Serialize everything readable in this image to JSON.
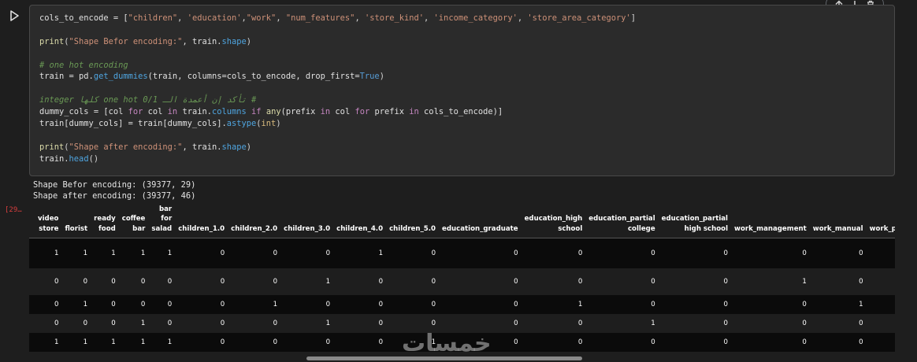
{
  "toolbar": {
    "move_up_icon": "arrow-up-icon",
    "move_down_icon": "arrow-down-icon",
    "delete_icon": "trash-icon"
  },
  "cell": {
    "run_icon": "play-icon",
    "execution_count": "[29…",
    "code_lines": [
      [
        {
          "t": "cols_to_encode = [",
          "c": "v"
        },
        {
          "t": "\"children\"",
          "c": "s"
        },
        {
          "t": ", ",
          "c": "p"
        },
        {
          "t": "'education'",
          "c": "s"
        },
        {
          "t": ",",
          "c": "p"
        },
        {
          "t": "\"work\"",
          "c": "s"
        },
        {
          "t": ", ",
          "c": "p"
        },
        {
          "t": "\"num_features\"",
          "c": "s"
        },
        {
          "t": ", ",
          "c": "p"
        },
        {
          "t": "'store_kind'",
          "c": "s"
        },
        {
          "t": ", ",
          "c": "p"
        },
        {
          "t": "'income_category'",
          "c": "s"
        },
        {
          "t": ", ",
          "c": "p"
        },
        {
          "t": "'store_area_category'",
          "c": "s"
        },
        {
          "t": "]",
          "c": "p"
        }
      ],
      [],
      [
        {
          "t": "print",
          "c": "fn"
        },
        {
          "t": "(",
          "c": "p"
        },
        {
          "t": "\"Shape Befor encoding:\"",
          "c": "s"
        },
        {
          "t": ", train.",
          "c": "v"
        },
        {
          "t": "shape",
          "c": "f"
        },
        {
          "t": ")",
          "c": "p"
        }
      ],
      [],
      [
        {
          "t": "# one hot encoding",
          "c": "c"
        }
      ],
      [
        {
          "t": "train = pd.",
          "c": "v"
        },
        {
          "t": "get_dummies",
          "c": "f"
        },
        {
          "t": "(train, columns=cols_to_encode, drop_first=",
          "c": "v"
        },
        {
          "t": "True",
          "c": "kw"
        },
        {
          "t": ")",
          "c": "p"
        }
      ],
      [],
      [
        {
          "t": "# تأكد إن أعمدة الـ one hot 0/1 كلها integer",
          "c": "c"
        }
      ],
      [
        {
          "t": "dummy_cols = [col ",
          "c": "v"
        },
        {
          "t": "for",
          "c": "k"
        },
        {
          "t": " col ",
          "c": "v"
        },
        {
          "t": "in",
          "c": "k"
        },
        {
          "t": " train.",
          "c": "v"
        },
        {
          "t": "columns",
          "c": "f"
        },
        {
          "t": " ",
          "c": "v"
        },
        {
          "t": "if",
          "c": "k"
        },
        {
          "t": " ",
          "c": "v"
        },
        {
          "t": "any",
          "c": "fn"
        },
        {
          "t": "(prefix ",
          "c": "v"
        },
        {
          "t": "in",
          "c": "k"
        },
        {
          "t": " col ",
          "c": "v"
        },
        {
          "t": "for",
          "c": "k"
        },
        {
          "t": " prefix ",
          "c": "v"
        },
        {
          "t": "in",
          "c": "k"
        },
        {
          "t": " cols_to_encode)]",
          "c": "v"
        }
      ],
      [
        {
          "t": "train[dummy_cols] = train[dummy_cols].",
          "c": "v"
        },
        {
          "t": "astype",
          "c": "f"
        },
        {
          "t": "(",
          "c": "p"
        },
        {
          "t": "int",
          "c": "b"
        },
        {
          "t": ")",
          "c": "p"
        }
      ],
      [],
      [
        {
          "t": "print",
          "c": "fn"
        },
        {
          "t": "(",
          "c": "p"
        },
        {
          "t": "\"Shape after encoding:\"",
          "c": "s"
        },
        {
          "t": ", train.",
          "c": "v"
        },
        {
          "t": "shape",
          "c": "f"
        },
        {
          "t": ")",
          "c": "p"
        }
      ],
      [
        {
          "t": "train.",
          "c": "v"
        },
        {
          "t": "head",
          "c": "f"
        },
        {
          "t": "()",
          "c": "p"
        }
      ]
    ]
  },
  "output": {
    "stdout": [
      "Shape Befor encoding: (39377, 29)",
      "Shape after encoding: (39377, 46)"
    ],
    "dataframe": {
      "columns": [
        [
          "video",
          "store"
        ],
        [
          "florist"
        ],
        [
          "ready",
          "food"
        ],
        [
          "coffee",
          "bar"
        ],
        [
          "bar",
          "for",
          "salad"
        ],
        [
          "children_1.0"
        ],
        [
          "children_2.0"
        ],
        [
          "children_3.0"
        ],
        [
          "children_4.0"
        ],
        [
          "children_5.0"
        ],
        [
          "education_graduate"
        ],
        [
          "education_high",
          "school"
        ],
        [
          "education_partial",
          "college"
        ],
        [
          "education_partial",
          "high school"
        ],
        [
          "work_management"
        ],
        [
          "work_manual"
        ],
        [
          "work_professional"
        ]
      ],
      "rows": [
        [
          "1",
          "1",
          "1",
          "1",
          "1",
          "0",
          "0",
          "0",
          "1",
          "0",
          "0",
          "0",
          "0",
          "0",
          "0",
          "0",
          ""
        ],
        [
          "0",
          "0",
          "0",
          "0",
          "0",
          "0",
          "0",
          "1",
          "0",
          "0",
          "0",
          "0",
          "0",
          "0",
          "1",
          "0",
          ""
        ],
        [
          "0",
          "1",
          "0",
          "0",
          "0",
          "0",
          "1",
          "0",
          "0",
          "0",
          "0",
          "1",
          "0",
          "0",
          "0",
          "1",
          ""
        ],
        [
          "0",
          "0",
          "0",
          "1",
          "0",
          "0",
          "0",
          "1",
          "0",
          "0",
          "0",
          "0",
          "1",
          "0",
          "0",
          "0",
          ""
        ],
        [
          "1",
          "1",
          "1",
          "1",
          "1",
          "0",
          "0",
          "0",
          "0",
          "1",
          "0",
          "0",
          "0",
          "0",
          "0",
          "0",
          ""
        ]
      ],
      "row_heights": [
        38,
        34,
        24,
        24,
        24
      ]
    },
    "watermark": "خمسات"
  },
  "colors": {
    "background": "#1e1e1e",
    "cell_background": "#2b2b2b",
    "string": "#ce9178",
    "keyword": "#c586c0",
    "comment": "#6a9955",
    "exec_count": "#d83e3e"
  }
}
